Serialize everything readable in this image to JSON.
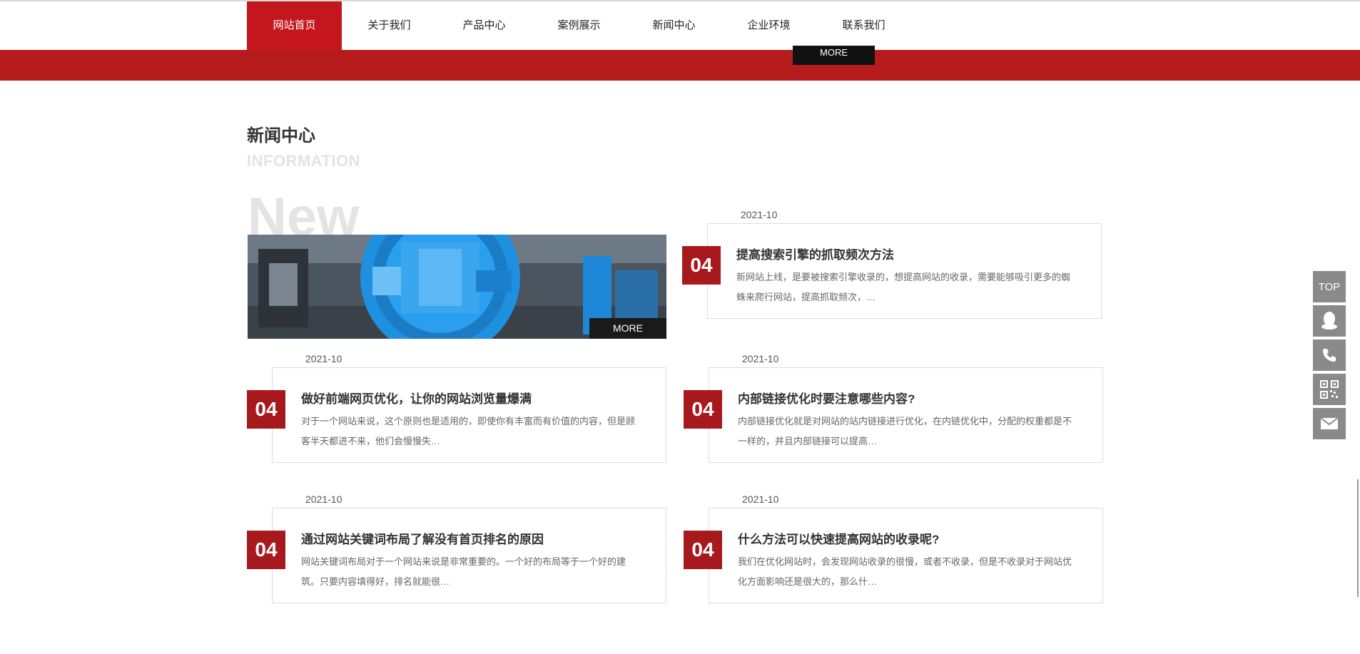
{
  "nav": {
    "items": [
      {
        "label": "网站首页",
        "active": true
      },
      {
        "label": "关于我们"
      },
      {
        "label": "产品中心"
      },
      {
        "label": "案例展示"
      },
      {
        "label": "新闻中心"
      },
      {
        "label": "企业环境"
      },
      {
        "label": "联系我们"
      }
    ]
  },
  "band": {
    "more_label": "MORE"
  },
  "section": {
    "title": "新闻中心",
    "subtitle": "INFORMATION",
    "bg_word": "New",
    "feature_more": "MORE"
  },
  "news": [
    {
      "date": "2021-10",
      "num": "04",
      "title": "提高搜索引擎的抓取频次方法",
      "desc": "新网站上线，是要被搜索引擎收录的，想提高网站的收录，需要能够吸引更多的蜘蛛来爬行网站，提高抓取频次，…"
    },
    {
      "date": "2021-10",
      "num": "04",
      "title": "做好前端网页优化，让你的网站浏览量爆满",
      "desc": "对于一个网站来说，这个原则也是适用的，即使你有丰富而有价值的内容，但是顾客半天都进不来，他们会慢慢失…"
    },
    {
      "date": "2021-10",
      "num": "04",
      "title": "内部链接优化时要注意哪些内容?",
      "desc": "内部链接优化就是对网站的站内链接进行优化，在内链优化中，分配的权重都是不一样的，并且内部链接可以提高…"
    },
    {
      "date": "2021-10",
      "num": "04",
      "title": "通过网站关键词布局了解没有首页排名的原因",
      "desc": "网站关键词布局对于一个网站来说是非常重要的。一个好的布局等于一个好的建筑。只要内容填得好，排名就能很…"
    },
    {
      "date": "2021-10",
      "num": "04",
      "title": "什么方法可以快速提高网站的收录呢?",
      "desc": "我们在优化网站时，会发现网站收录的很慢，或者不收录，但是不收录对于网站优化方面影响还是很大的，那么什…"
    }
  ],
  "sidebar": {
    "top_label": "TOP",
    "icons": [
      "qq-icon",
      "phone-icon",
      "qrcode-icon",
      "mail-icon"
    ]
  },
  "colors": {
    "brand_red": "#c4161c",
    "band_red": "#b71c1c",
    "number_red": "#a8191e",
    "sidebar_gray": "#8a8a8a"
  }
}
